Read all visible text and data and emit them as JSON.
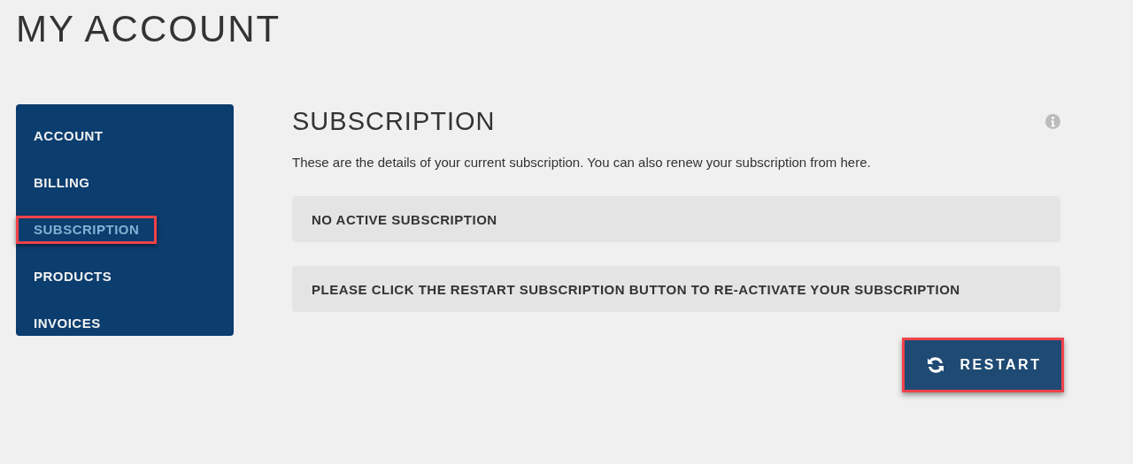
{
  "page_title": "MY ACCOUNT",
  "sidebar": {
    "items": [
      {
        "label": "ACCOUNT",
        "selected": false,
        "highlighted": false
      },
      {
        "label": "BILLING",
        "selected": false,
        "highlighted": false
      },
      {
        "label": "SUBSCRIPTION",
        "selected": true,
        "highlighted": true
      },
      {
        "label": "PRODUCTS",
        "selected": false,
        "highlighted": false
      },
      {
        "label": "INVOICES",
        "selected": false,
        "highlighted": false
      }
    ]
  },
  "section": {
    "title": "SUBSCRIPTION",
    "description": "These are the details of your current subscription. You can also renew your subscription from here.",
    "notices": [
      "NO ACTIVE SUBSCRIPTION",
      "PLEASE CLICK THE RESTART SUBSCRIPTION BUTTON TO RE-ACTIVATE YOUR SUBSCRIPTION"
    ],
    "button": {
      "label": "RESTART",
      "highlighted": true
    }
  }
}
